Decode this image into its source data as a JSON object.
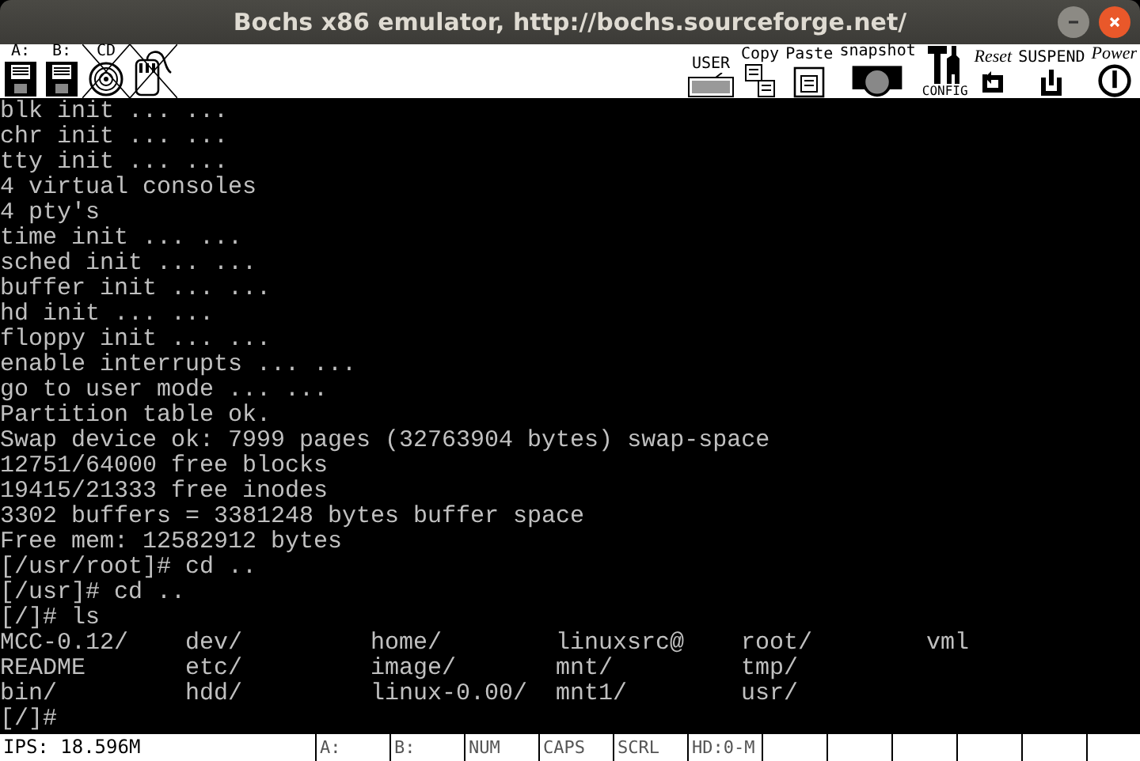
{
  "window": {
    "title": "Bochs x86 emulator, http://bochs.sourceforge.net/"
  },
  "toolbar": {
    "left": [
      {
        "kind": "floppy",
        "label": "A:",
        "disabled": false
      },
      {
        "kind": "floppy",
        "label": "B:",
        "disabled": false
      },
      {
        "kind": "cdrom",
        "label": "CD",
        "disabled": true
      },
      {
        "kind": "mouse",
        "disabled": true
      }
    ],
    "right": [
      {
        "kind": "keyboard",
        "label": "USER"
      },
      {
        "kind": "copy",
        "label": "Copy"
      },
      {
        "kind": "paste",
        "label": "Paste"
      },
      {
        "kind": "camera",
        "label": "snapshot"
      },
      {
        "kind": "config",
        "label": "CONFIG"
      },
      {
        "kind": "reset",
        "label": "Reset"
      },
      {
        "kind": "suspend",
        "label": "SUSPEND"
      },
      {
        "kind": "power",
        "label": "Power"
      }
    ]
  },
  "terminal": {
    "lines": [
      "blk init ... ...",
      "chr init ... ...",
      "tty init ... ...",
      "4 virtual consoles",
      "4 pty's",
      "time init ... ...",
      "sched init ... ...",
      "buffer init ... ...",
      "hd init ... ...",
      "floppy init ... ...",
      "enable interrupts ... ...",
      "go to user mode ... ...",
      "Partition table ok.",
      "Swap device ok: 7999 pages (32763904 bytes) swap-space",
      "12751/64000 free blocks",
      "19415/21333 free inodes",
      "3302 buffers = 3381248 bytes buffer space",
      "Free mem: 12582912 bytes",
      "[/usr/root]# cd ..",
      "[/usr]# cd ..",
      "[/]# ls"
    ],
    "listing": [
      [
        "MCC-0.12/",
        "dev/",
        "home/",
        "linuxsrc@",
        "root/",
        "vml"
      ],
      [
        "README",
        "etc/",
        "image/",
        "mnt/",
        "tmp/"
      ],
      [
        "bin/",
        "hdd/",
        "linux-0.00/",
        "mnt1/",
        "usr/"
      ]
    ],
    "lines_after": [
      "[/]#"
    ]
  },
  "status_bar": {
    "ips": "IPS: 18.596M",
    "cells": [
      "A:",
      "B:",
      "NUM",
      "CAPS",
      "SCRL",
      "HD:0-M"
    ]
  }
}
